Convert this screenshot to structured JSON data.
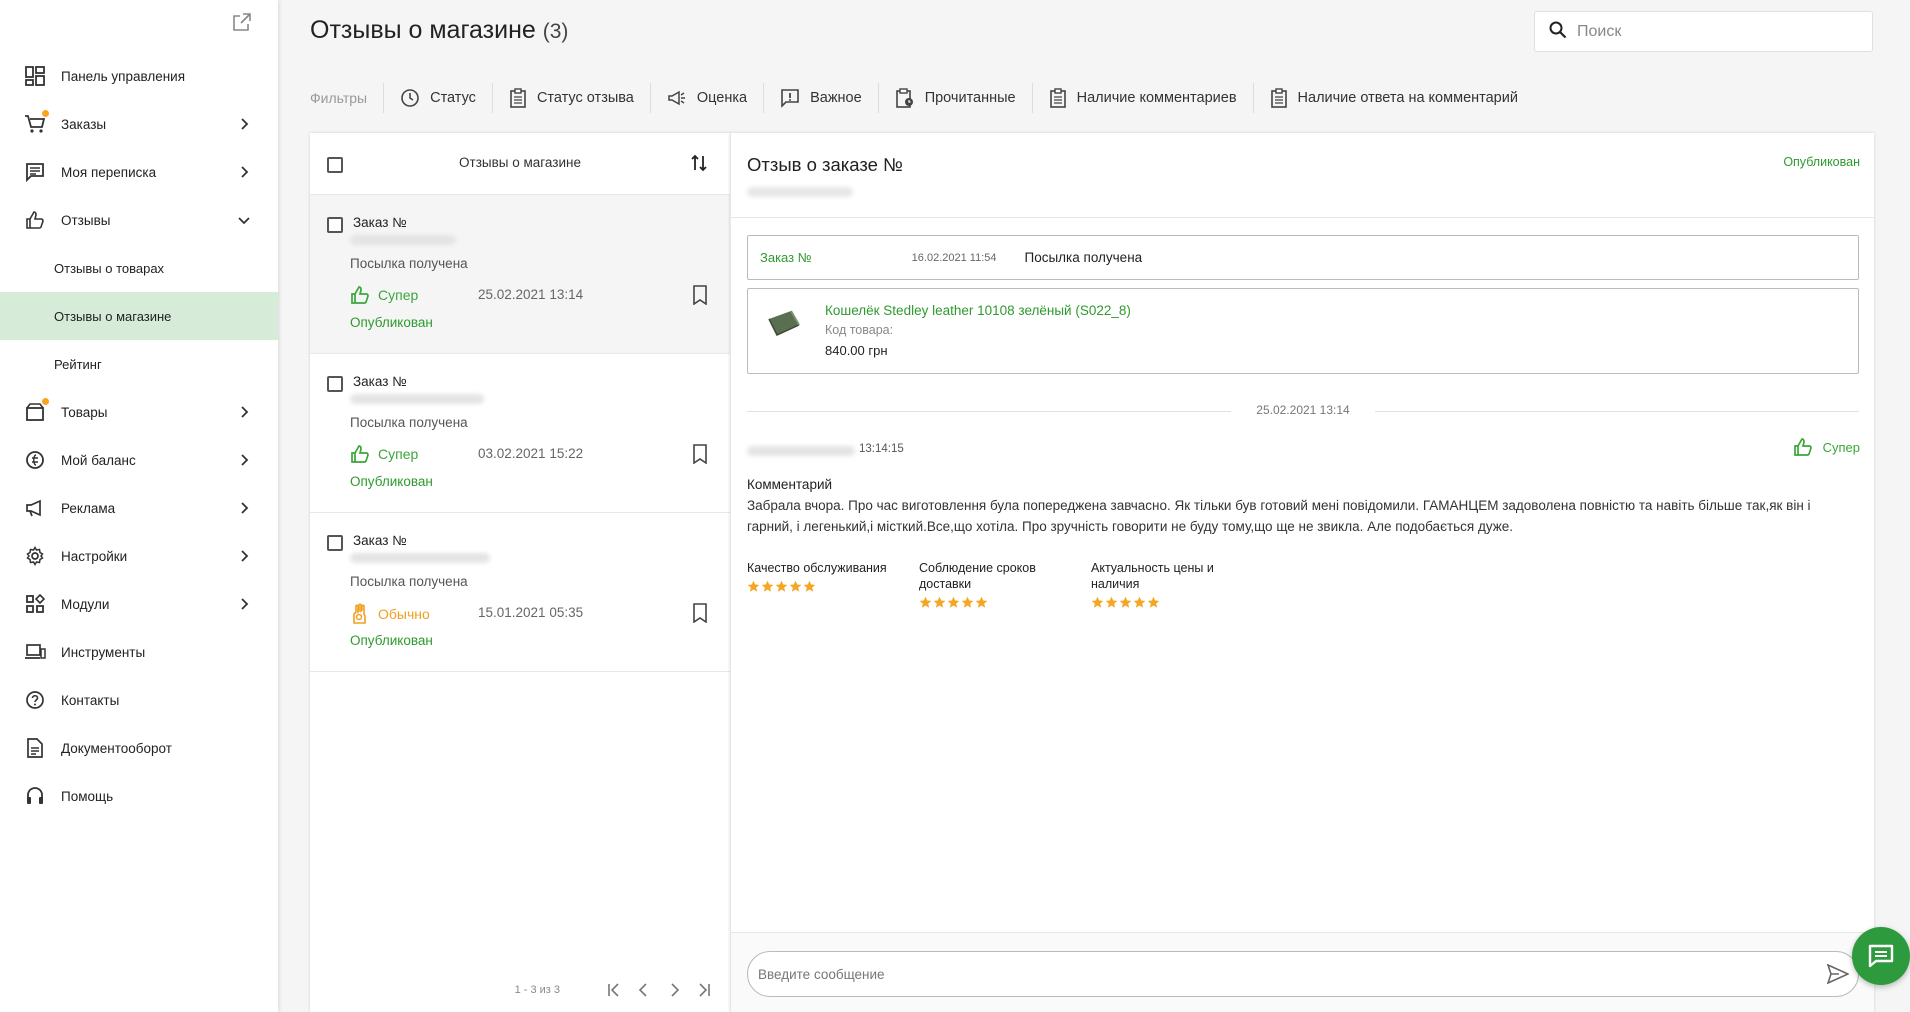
{
  "sidebar": {
    "items": [
      {
        "label": "Панель управления",
        "icon": "dashboard-icon"
      },
      {
        "label": "Заказы",
        "icon": "cart-icon"
      },
      {
        "label": "Моя переписка",
        "icon": "chat-icon"
      },
      {
        "label": "Отзывы",
        "icon": "thumb-up-icon"
      },
      {
        "label": "Товары",
        "icon": "box-icon"
      },
      {
        "label": "Мой баланс",
        "icon": "balance-icon"
      },
      {
        "label": "Реклама",
        "icon": "megaphone-icon"
      },
      {
        "label": "Настройки",
        "icon": "gear-icon"
      },
      {
        "label": "Модули",
        "icon": "modules-icon"
      },
      {
        "label": "Инструменты",
        "icon": "devices-icon"
      },
      {
        "label": "Контакты",
        "icon": "help-circle-icon"
      },
      {
        "label": "Документооборот",
        "icon": "document-icon"
      },
      {
        "label": "Помощь",
        "icon": "headset-icon"
      }
    ],
    "reviews_sub": [
      "Отзывы о товарах",
      "Отзывы о магазине",
      "Рейтинг"
    ]
  },
  "header": {
    "title": "Отзывы о магазине",
    "count": "(3)",
    "search_placeholder": "Поиск"
  },
  "filters": {
    "label": "Фильтры",
    "items": [
      "Статус",
      "Статус отзыва",
      "Оценка",
      "Важное",
      "Прочитанные",
      "Наличие комментариев",
      "Наличие ответа на комментарий"
    ]
  },
  "list": {
    "title": "Отзывы о магазине",
    "reviews": [
      {
        "order": "Заказ №",
        "status": "Посылка получена",
        "rating": "Супер",
        "date": "25.02.2021 13:14",
        "published": "Опубликован"
      },
      {
        "order": "Заказ №",
        "status": "Посылка получена",
        "rating": "Супер",
        "date": "03.02.2021 15:22",
        "published": "Опубликован"
      },
      {
        "order": "Заказ №",
        "status": "Посылка получена",
        "rating": "Обычно",
        "date": "15.01.2021 05:35",
        "published": "Опубликован"
      }
    ],
    "pager": "1 - 3 из 3"
  },
  "detail": {
    "title": "Отзыв о заказе №",
    "status": "Опубликован",
    "order": {
      "link": "Заказ №",
      "date": "16.02.2021 11:54",
      "status": "Посылка получена"
    },
    "product": {
      "name": "Кошелёк Stedley leather 10108 зелёный (S022_8)",
      "code_label": "Код товара:",
      "price": "840.00 грн"
    },
    "separator_date": "25.02.2021 13:14",
    "comment": {
      "time": "13:14:15",
      "rating": "Супер",
      "label": "Комментарий",
      "text": "Забрала вчора. Про час виготовлення була попереджена завчасно. Як тільки був готовий мені повідомили. ГАМАНЦЕМ задоволена повністю та навіть більше так,як він і гарний, і легенький,і місткий.Все,що хотіла. Про зручність говорити не буду тому,що ще не звикла. Але подобається дуже."
    },
    "criteria": [
      {
        "label": "Качество обслуживания",
        "stars": 5
      },
      {
        "label": "Соблюдение сроков доставки",
        "stars": 5
      },
      {
        "label": "Актуальность цены и наличия",
        "stars": 5
      }
    ],
    "message_placeholder": "Введите сообщение"
  },
  "colors": {
    "accent": "#2e9a2e",
    "orange": "#f0a020",
    "active_bg": "#d6ecd9",
    "star": "#f5a623"
  }
}
